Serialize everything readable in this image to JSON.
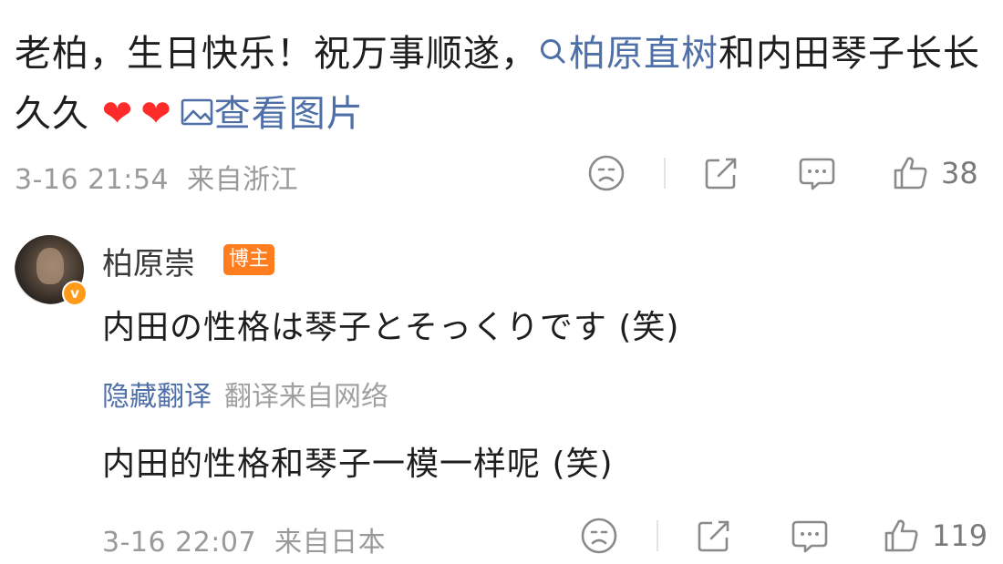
{
  "top_comment": {
    "text_before": "老柏，生日快乐！祝万事顺遂，",
    "search_link": "柏原直树",
    "text_middle": "和内田琴子长长久久",
    "hearts": [
      "❤",
      "❤"
    ],
    "view_image_link": "查看图片",
    "timestamp": "3-16 21:54",
    "location": "来自浙江",
    "like_count": "38"
  },
  "reply": {
    "username": "柏原崇",
    "badge": "博主",
    "verified_mark": "v",
    "text": "内田の性格は琴子とそっくりです (笑)",
    "hide_translation": "隐藏翻译",
    "translation_source": "翻译来自网络",
    "translated_text": "内田的性格和琴子一模一样呢 (笑)",
    "timestamp": "3-16 22:07",
    "location": "来自日本",
    "like_count": "119"
  },
  "colors": {
    "link": "#4f6fa8",
    "badge": "#ff7d1f",
    "heart": "#ff2b2b"
  }
}
